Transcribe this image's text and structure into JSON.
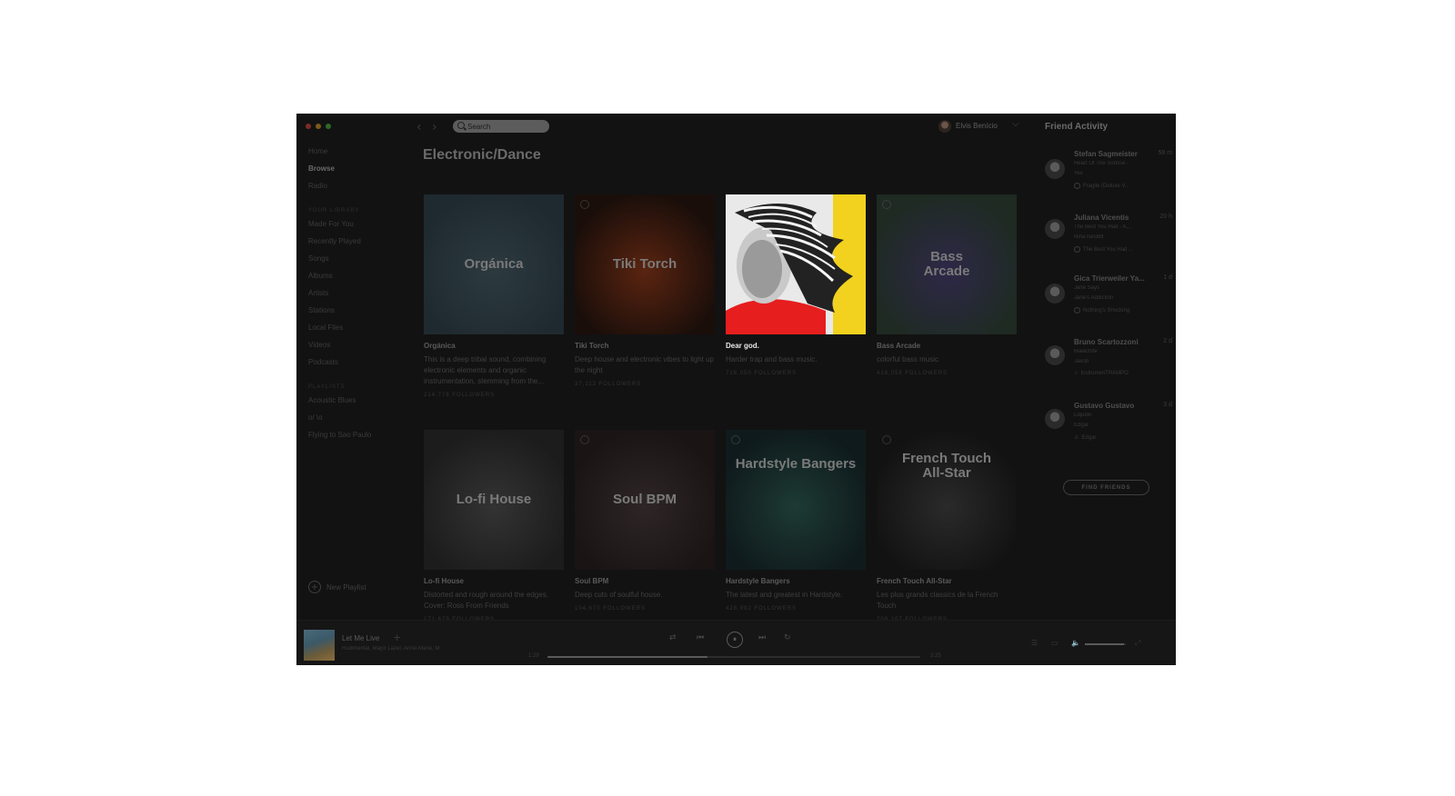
{
  "window": {
    "traffic_colors": [
      "#7a2b26",
      "#7a5a1e",
      "#2d6a2a"
    ]
  },
  "topbar": {
    "back_glyph": "‹",
    "forward_glyph": "›",
    "search_placeholder": "Search",
    "user_name": "Elvis Benício",
    "user_chevron": "⌵"
  },
  "sidebar": {
    "nav": [
      "Home",
      "Browse",
      "Radio"
    ],
    "library_label": "YOUR LIBRARY",
    "library": [
      "Made For You",
      "Recently Played",
      "Songs",
      "Albums",
      "Artists",
      "Stations",
      "Local Files",
      "Videos",
      "Podcasts"
    ],
    "playlists_label": "PLAYLISTS",
    "playlists": [
      "Acoustic Blues",
      "o/ \\o",
      "Flying to Sao Paulo"
    ],
    "new_playlist": "New Playlist",
    "new_playlist_glyph": "+"
  },
  "main": {
    "title": "Electronic/Dance",
    "cards": [
      {
        "cover_title": "Orgánica",
        "name": "Orgánica",
        "desc": "This is a deep tribal sound, combining electronic elements and organic instrumentation, stemming from the...",
        "followers": "214,776 FOLLOWERS",
        "colors": [
          "#1f2a30",
          "#2c3a40"
        ]
      },
      {
        "cover_title": "Tiki Torch",
        "name": "Tiki Torch",
        "desc": "Deep house and electronic vibes to light up the night",
        "followers": "37,112 FOLLOWERS",
        "colors": [
          "#1a0e0a",
          "#5a2410"
        ]
      },
      {
        "cover_title": "",
        "name": "Dear god.",
        "desc": "Harder trap and bass music.",
        "followers": "728,050 FOLLOWERS",
        "colors": [
          "#e9e9e9",
          "#e61e1e",
          "#f2d21e"
        ]
      },
      {
        "cover_title": "Bass Arcade",
        "name": "Bass Arcade",
        "desc": "colorful bass music",
        "followers": "418,058 FOLLOWERS",
        "colors": [
          "#1e2a22",
          "#2e2848"
        ]
      },
      {
        "cover_title": "Lo-fi House",
        "name": "Lo-fi House",
        "desc": "Distorted and rough around the edges. Cover: Ross From Friends",
        "followers": "171,679 FOLLOWERS",
        "colors": [
          "#1c1c1c",
          "#333333"
        ]
      },
      {
        "cover_title": "Soul BPM",
        "name": "Soul BPM",
        "desc": "Deep cuts of soulful house.",
        "followers": "104,670 FOLLOWERS",
        "colors": [
          "#1a1414",
          "#2e2626"
        ]
      },
      {
        "cover_title": "Hardstyle Bangers",
        "name": "Hardstyle Bangers",
        "desc": "The latest and greatest in Hardstyle.",
        "followers": "428,992 FOLLOWERS",
        "colors": [
          "#0f1a1c",
          "#1d3a34"
        ]
      },
      {
        "cover_title": "French Touch All-Star",
        "name": "French Touch All-Star",
        "desc": "Les plus grands classics de la French Touch",
        "followers": "209,107 FOLLOWERS",
        "colors": [
          "#121212",
          "#2a2a2a"
        ]
      }
    ]
  },
  "friends": {
    "title": "Friend Activity",
    "items": [
      {
        "name": "Stefan Sagmeister",
        "time": "58 m",
        "track": "Heart Of The Sunrise -",
        "artist": "Yes",
        "context": "Fragile (Deluxe V..."
      },
      {
        "name": "Juliana Vicentis",
        "time": "20 h",
        "track": "The Best You Had - A...",
        "artist": "Nina Nesbitt",
        "context": "The Best You Had ..."
      },
      {
        "name": "Gica Trierweiler Ya...",
        "time": "1 d",
        "track": "Jane Says",
        "artist": "Jane's Addiction",
        "context": "Nothing's Shocking"
      },
      {
        "name": "Bruno Scartozzoni",
        "time": "2 d",
        "track": "Malachite",
        "artist": "Jakob",
        "context": "InstrumenTRAMPO"
      },
      {
        "name": "Gustavo Gustavo",
        "time": "3 d",
        "track": "Liquido",
        "artist": "Edgar",
        "context": "Edgar"
      }
    ],
    "find_friends": "FIND FRIENDS"
  },
  "player": {
    "title": "Let Me Live",
    "artist": "Rudimental, Major Lazer, Anne-Marie, M",
    "add_glyph": "+",
    "elapsed": "1:29",
    "total": "3:25",
    "progress": 0.43,
    "volume": 0.95,
    "shuffle_glyph": "⇄",
    "prev_glyph": "⏮",
    "pause_glyph": "⏸",
    "next_glyph": "⏭",
    "repeat_glyph": "↻",
    "queue_glyph": "☰",
    "devices_glyph": "▭",
    "volume_glyph": "🔈",
    "fullscreen_glyph": "⤢"
  }
}
